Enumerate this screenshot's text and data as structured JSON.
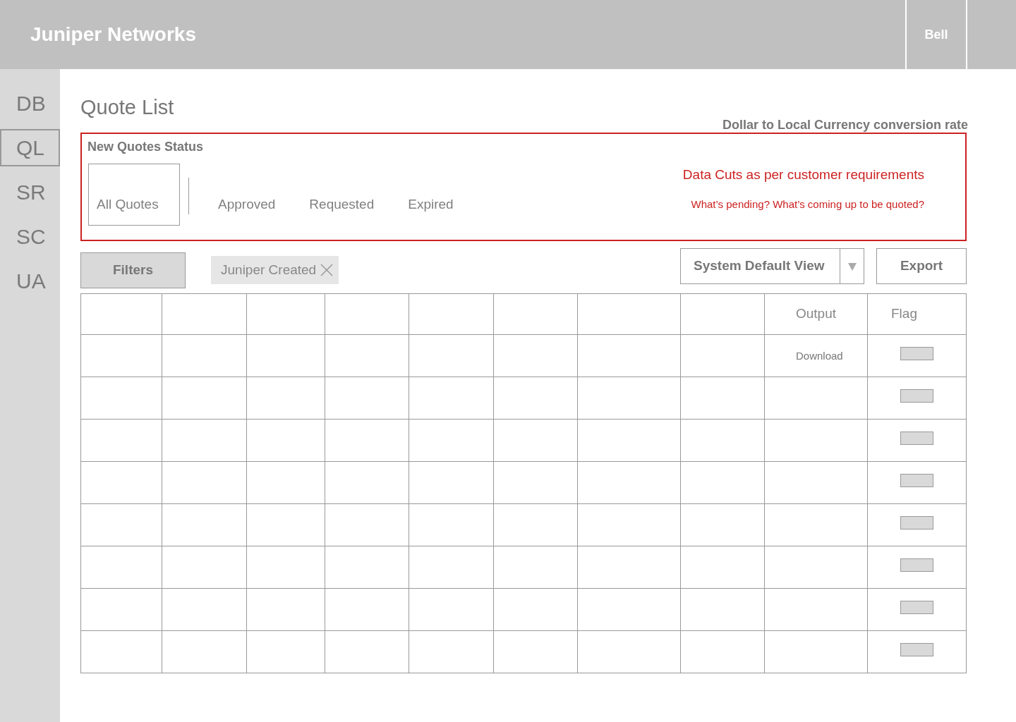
{
  "header": {
    "title": "Juniper Networks",
    "user": "Bell"
  },
  "sidebar": {
    "items": [
      {
        "label": "DB",
        "selected": false
      },
      {
        "label": "QL",
        "selected": true
      },
      {
        "label": "SR",
        "selected": false
      },
      {
        "label": "SC",
        "selected": false
      },
      {
        "label": "UA",
        "selected": false
      }
    ]
  },
  "page_title": "Quote List",
  "conversion_rate_label": "Dollar to Local Currency conversion rate",
  "status_panel": {
    "title": "New Quotes Status",
    "tabs": [
      {
        "label": "All Quotes",
        "selected": true
      },
      {
        "label": "Approved",
        "selected": false
      },
      {
        "label": "Requested",
        "selected": false
      },
      {
        "label": "Expired",
        "selected": false
      }
    ],
    "notes": [
      "Data Cuts as per customer requirements",
      "What’s pending? What’s coming up to be quoted?"
    ]
  },
  "toolbar": {
    "filters_button": "Filters",
    "filter_chips": [
      {
        "label": "Juniper Created"
      }
    ],
    "view_select": {
      "value": "System Default View"
    },
    "export_button": "Export"
  },
  "table": {
    "columns": [
      {
        "kind": "blank"
      },
      {
        "kind": "blank"
      },
      {
        "kind": "blank"
      },
      {
        "kind": "blank"
      },
      {
        "kind": "blank"
      },
      {
        "kind": "blank"
      },
      {
        "kind": "blank"
      },
      {
        "kind": "blank"
      },
      {
        "kind": "output",
        "label": "Output"
      },
      {
        "kind": "flag",
        "label": "Flag"
      }
    ],
    "rows": [
      {
        "kind": "download",
        "output": "Download"
      },
      {
        "kind": "plain"
      },
      {
        "kind": "plain"
      },
      {
        "kind": "plain"
      },
      {
        "kind": "plain"
      },
      {
        "kind": "plain"
      },
      {
        "kind": "plain"
      },
      {
        "kind": "plain"
      }
    ]
  }
}
